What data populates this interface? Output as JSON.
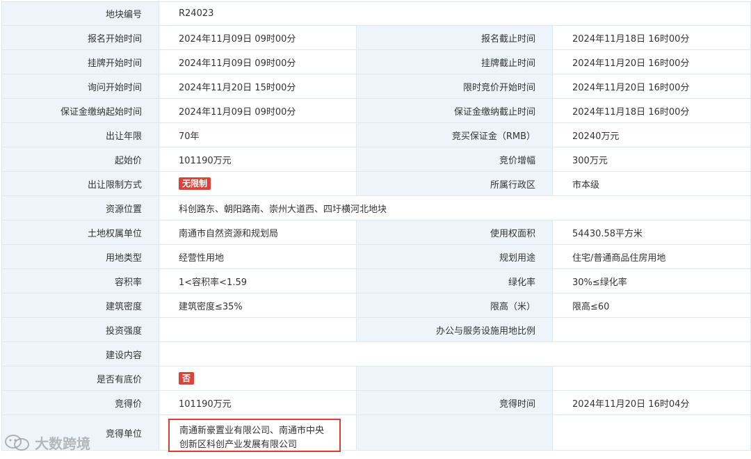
{
  "rows": [
    {
      "type": "full",
      "label": "地块编号",
      "value": "R24023"
    },
    {
      "type": "pair",
      "l1": "报名开始时间",
      "v1": "2024年11月09日 09时00分",
      "l2": "报名截止时间",
      "v2": "2024年11月18日 16时00分"
    },
    {
      "type": "pair",
      "l1": "挂牌开始时间",
      "v1": "2024年11月09日 09时00分",
      "l2": "挂牌截止时间",
      "v2": "2024年11月20日 16时00分"
    },
    {
      "type": "pair",
      "l1": "询问开始时间",
      "v1": "2024年11月20日 15时00分",
      "l2": "限时竞价开始时间",
      "v2": "2024年11月20日 16时00分"
    },
    {
      "type": "pair",
      "l1": "保证金缴纳起始时间",
      "v1": "2024年11月09日 09时00分",
      "l2": "保证金缴纳截止时间",
      "v2": "2024年11月18日 16时00分"
    },
    {
      "type": "pair",
      "l1": "出让年限",
      "v1": "70年",
      "l2": "竞买保证金（RMB）",
      "v2": "20240万元"
    },
    {
      "type": "pair",
      "l1": "起始价",
      "v1": "101190万元",
      "l2": "竞价增幅",
      "v2": "300万元"
    },
    {
      "type": "pair",
      "l1": "出让限制方式",
      "v1": "无限制",
      "v1_badge": true,
      "l2": "所属行政区",
      "v2": "市本级"
    },
    {
      "type": "full",
      "label": "资源位置",
      "value": "科创路东、朝阳路南、崇州大道西、四圩横河北地块"
    },
    {
      "type": "pair",
      "l1": "土地权属单位",
      "v1": "南通市自然资源和规划局",
      "l2": "使用权面积",
      "v2": "54430.58平方米"
    },
    {
      "type": "pair",
      "l1": "用地类型",
      "v1": "经营性用地",
      "l2": "规划用途",
      "v2": "住宅/普通商品住房用地"
    },
    {
      "type": "pair",
      "l1": "容积率",
      "v1": "1<容积率<1.59",
      "l2": "绿化率",
      "v2": "30%≤绿化率"
    },
    {
      "type": "pair",
      "l1": "建筑密度",
      "v1": "建筑密度≤35%",
      "l2": "限高（米）",
      "v2": "限高≤60"
    },
    {
      "type": "pair",
      "l1": "投资强度",
      "v1": "",
      "l2": "办公与服务设施用地比例",
      "v2": ""
    },
    {
      "type": "full",
      "label": "建设内容",
      "value": ""
    },
    {
      "type": "pair",
      "l1": "是否有底价",
      "v1": "否",
      "v1_badge": true,
      "l2": "",
      "v2": "",
      "l2_empty": true
    },
    {
      "type": "pair",
      "l1": "竞得价",
      "v1": "101190万元",
      "l2": "竞得时间",
      "v2": "2024年11月20日 16时04分"
    },
    {
      "type": "winner",
      "l1": "竞得单位",
      "v1": "南通新豪置业有限公司、南通市中央创新区科创产业发展有限公司"
    }
  ],
  "watermark": {
    "text": "大数跨境",
    "icon": "wechat-logo-icon"
  },
  "colors": {
    "label_bg": "#eef4fa",
    "border": "#dfe7ef",
    "badge": "#d9443a",
    "highlight": "#e03a3a"
  }
}
